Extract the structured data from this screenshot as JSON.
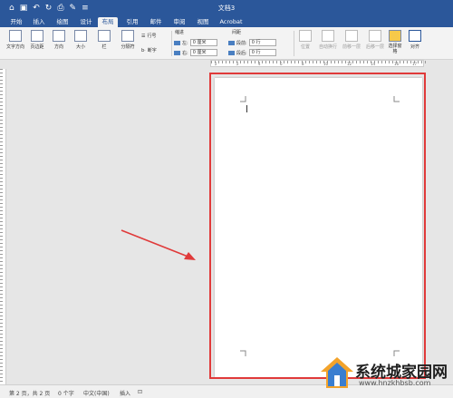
{
  "window": {
    "title": "文档3"
  },
  "qat": [
    "home-icon",
    "save-icon",
    "undo-icon",
    "redo-icon",
    "print-icon",
    "edit-icon",
    "customize-icon"
  ],
  "tabs": [
    {
      "label": "开始"
    },
    {
      "label": "插入"
    },
    {
      "label": "绘图"
    },
    {
      "label": "设计"
    },
    {
      "label": "布局",
      "active": true
    },
    {
      "label": "引用"
    },
    {
      "label": "邮件"
    },
    {
      "label": "审阅"
    },
    {
      "label": "视图"
    },
    {
      "label": "Acrobat"
    }
  ],
  "ribbon": {
    "text_direction": "文字方向",
    "margins": "页边距",
    "orientation": "方向",
    "size": "大小",
    "columns": "栏",
    "breaks": "分隔符",
    "line_numbers": "行号",
    "hyphenation": "断字",
    "indent": {
      "title": "缩进",
      "left_label": "左:",
      "left_value": "0 厘米",
      "right_label": "右:",
      "right_value": "0 厘米"
    },
    "spacing": {
      "title": "间距",
      "before_label": "段前:",
      "before_value": "0 行",
      "after_label": "段后:",
      "after_value": "0 行"
    },
    "arrange": {
      "position": "位置",
      "wrap_text": "自动换行",
      "bring_forward": "前移一层",
      "send_backward": "后移一层",
      "selection_pane": "选择窗格",
      "align": "对齐"
    }
  },
  "ruler": {
    "marks": [
      "2",
      "2",
      "4",
      "6",
      "8",
      "10",
      "12",
      "14",
      "16",
      "17"
    ]
  },
  "status": {
    "page": "第 2 页，共 2 页",
    "words": "0 个字",
    "language": "中文(中国)",
    "mode": "插入"
  },
  "watermark": {
    "title": "系统城家园网",
    "url": "www.hnzkhbsb.com"
  },
  "colors": {
    "accent": "#2b579a",
    "highlight": "#e03a3a",
    "arrow": "#e03a3a"
  }
}
